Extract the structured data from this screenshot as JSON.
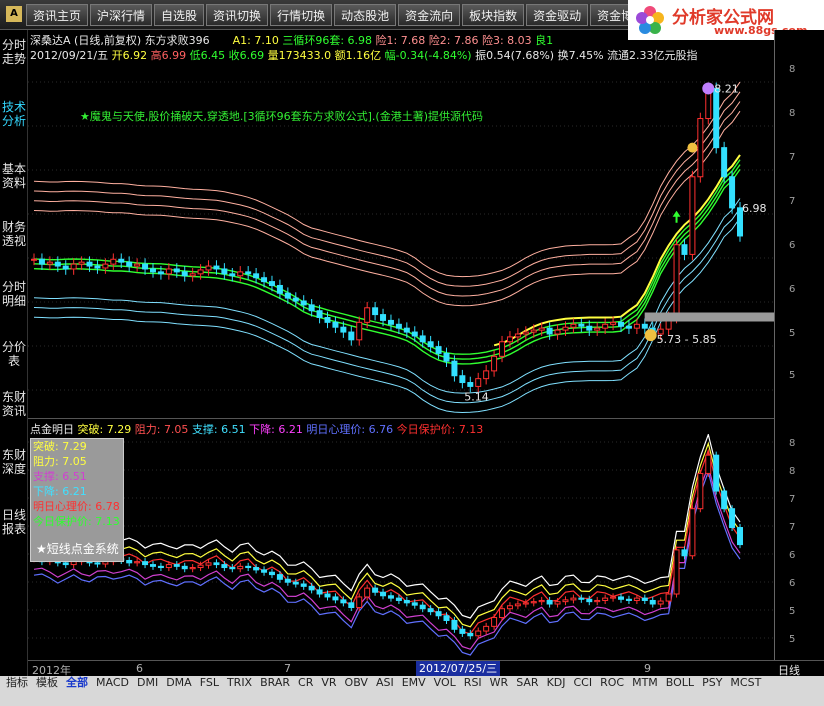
{
  "app": {
    "logo_letter": "A"
  },
  "nav": {
    "tabs": [
      "资讯主页",
      "沪深行情",
      "自选股",
      "资讯切换",
      "行情切换",
      "动态股池",
      "资金流向",
      "板块指数",
      "资金驱动",
      "资金博弈"
    ]
  },
  "brand": {
    "title": "分析家公式网",
    "url": "www.88gs.com"
  },
  "sidebar": {
    "items": [
      {
        "label": "分时走势",
        "active": false
      },
      {
        "label": "技术分析",
        "active": true
      },
      {
        "label": "基本资料",
        "active": false
      },
      {
        "label": "财务透视",
        "active": false
      },
      {
        "label": "分时明细",
        "active": false
      },
      {
        "label": "分价表",
        "active": false
      },
      {
        "label": "东财资讯",
        "active": false
      },
      {
        "label": "东财深度",
        "active": false
      },
      {
        "label": "日线报表",
        "active": false
      }
    ]
  },
  "header": {
    "stock": "深桑达A",
    "mode": "(日线,前复权)",
    "formula": "东方求败396",
    "a1": "A1: 7.10",
    "cycle": "三循环96套: 6.98",
    "risk1": "险1: 7.68",
    "risk2": "险2: 7.86",
    "risk3": "险3: 8.03",
    "good1": "良1",
    "date": "2012/09/21/五",
    "open": "开6.92",
    "high": "高6.99",
    "low": "低6.45",
    "close": "收6.69",
    "volume": "量173433.0",
    "amount": "额1.16亿",
    "change": "幅-0.34(-4.84%)",
    "amplitude": "振0.54(7.68%)",
    "turnover": "换7.45%",
    "float": "流通2.33亿元股指"
  },
  "annotation": "★魔鬼与天使,股价捅破天,穿透地.[3循环96套东方求败公式].(金港土著)提供源代码",
  "price_labels": {
    "peak": "8.21",
    "last": "6.98",
    "low": "5.14",
    "range": "5.73 - 5.85"
  },
  "right_axis": {
    "main": [
      "8",
      "8",
      "7",
      "7",
      "6",
      "6",
      "5",
      "5"
    ],
    "sub": [
      "8",
      "8",
      "7",
      "7",
      "6",
      "6",
      "5",
      "5"
    ]
  },
  "sub_panel": {
    "name": "点金明日",
    "breakout": {
      "label": "突破:",
      "value": "7.29"
    },
    "resistance": {
      "label": "阻力:",
      "value": "7.05"
    },
    "support": {
      "label": "支撑:",
      "value": "6.51"
    },
    "decline": {
      "label": "下降:",
      "value": "6.21"
    },
    "psych": {
      "label": "明日心理价:",
      "value": "6.76"
    },
    "protect": {
      "label": "今日保护价:",
      "value": "7.13"
    }
  },
  "legend": {
    "lines": [
      "突破: 7.29",
      "阻力: 7.05",
      "支撑: 6.51",
      "下降: 6.21",
      "明日心理价: 6.78",
      "今日保护价: 7.13"
    ],
    "title": "★短线点金系统"
  },
  "date_axis": {
    "year": "2012年",
    "m6": "6",
    "m7": "7",
    "cursor_date": "2012/07/25/三",
    "m9": "9",
    "period": "日线"
  },
  "bottom_tabs": [
    "指标",
    "模板",
    "全部",
    "MACD",
    "DMI",
    "DMA",
    "FSL",
    "TRIX",
    "BRAR",
    "CR",
    "VR",
    "OBV",
    "ASI",
    "EMV",
    "VOL",
    "RSI",
    "WR",
    "SAR",
    "KDJ",
    "CCI",
    "ROC",
    "MTM",
    "BOLL",
    "PSY",
    "MCST"
  ],
  "colors": {
    "price_up": "#ff3030",
    "price_down": "#33e0ff",
    "ma_yellow": "#ffff40",
    "ma_green": "#30ff30",
    "band_pink": "#ffb0a0",
    "band_cyan": "#80e0ff",
    "accent_blue": "#1a2ea0"
  },
  "chart_data": [
    {
      "type": "candlestick",
      "title": "深桑达A 日线 前复权",
      "x_range": [
        "2012-05",
        "2012-09-21"
      ],
      "ylim": [
        5.0,
        8.4
      ],
      "last_bar": {
        "date": "2012/09/21",
        "open": 6.92,
        "high": 6.99,
        "low": 6.45,
        "close": 6.69
      },
      "closes": [
        6.45,
        6.4,
        6.42,
        6.38,
        6.35,
        6.4,
        6.42,
        6.38,
        6.36,
        6.4,
        6.45,
        6.42,
        6.38,
        6.4,
        6.35,
        6.32,
        6.3,
        6.35,
        6.32,
        6.28,
        6.3,
        6.34,
        6.38,
        6.35,
        6.3,
        6.28,
        6.32,
        6.3,
        6.26,
        6.22,
        6.18,
        6.1,
        6.05,
        6.02,
        5.98,
        5.92,
        5.85,
        5.8,
        5.75,
        5.7,
        5.62,
        5.8,
        5.95,
        5.88,
        5.82,
        5.78,
        5.74,
        5.7,
        5.66,
        5.6,
        5.55,
        5.48,
        5.4,
        5.25,
        5.18,
        5.14,
        5.22,
        5.3,
        5.45,
        5.6,
        5.65,
        5.68,
        5.7,
        5.72,
        5.74,
        5.68,
        5.72,
        5.75,
        5.78,
        5.76,
        5.72,
        5.74,
        5.78,
        5.8,
        5.76,
        5.74,
        5.78,
        5.74,
        5.68,
        5.73,
        5.85,
        6.6,
        6.5,
        7.3,
        7.9,
        8.21,
        7.6,
        7.3,
        6.98,
        6.69
      ],
      "annotations": {
        "peak": 8.21,
        "low": 5.14,
        "last": 6.98,
        "range": [
          5.73,
          5.85
        ]
      }
    },
    {
      "type": "line",
      "title": "点金明日",
      "ylim": [
        5.0,
        8.4
      ],
      "series": [
        {
          "name": "突破",
          "last": 7.29
        },
        {
          "name": "阻力",
          "last": 7.05
        },
        {
          "name": "支撑",
          "last": 6.51
        },
        {
          "name": "下降",
          "last": 6.21
        },
        {
          "name": "明日心理价",
          "last": 6.76
        },
        {
          "name": "今日保护价",
          "last": 7.13
        }
      ]
    }
  ]
}
